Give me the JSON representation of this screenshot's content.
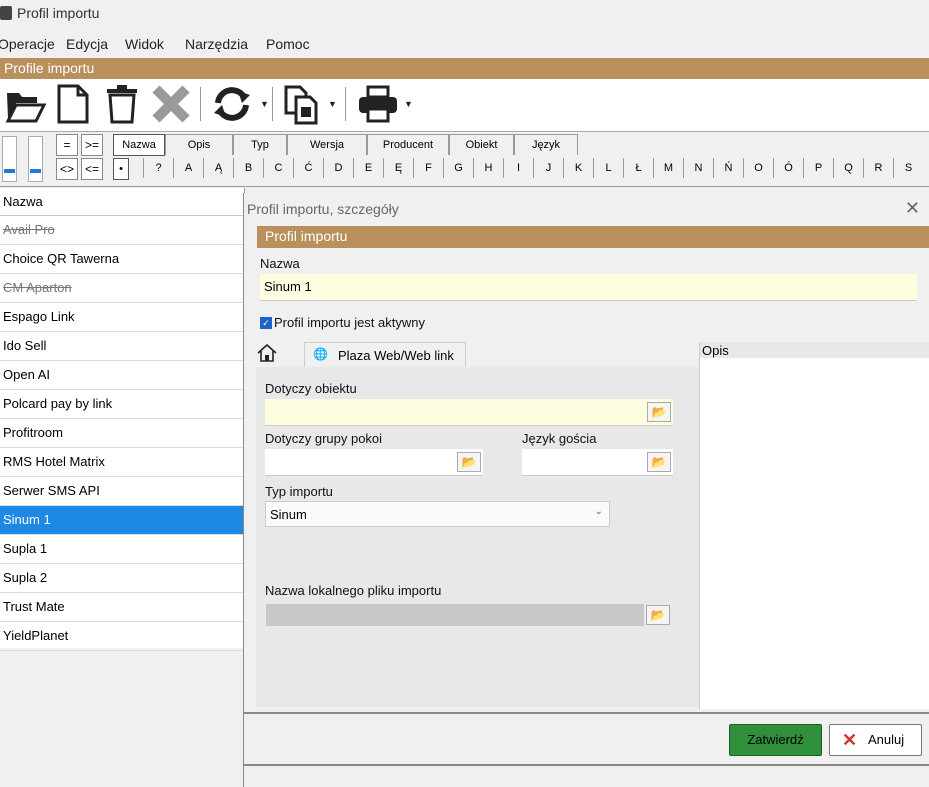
{
  "window": {
    "title": "Profil importu"
  },
  "menu": [
    "Operacje",
    "Edycja",
    "Widok",
    "Narzędzia",
    "Pomoc"
  ],
  "main_header": "Profile importu",
  "toolbar": {
    "icons": [
      "open-folder-icon",
      "new-document-icon",
      "trash-icon",
      "delete-x-icon",
      "refresh-icon",
      "export-icon",
      "print-icon"
    ]
  },
  "filter": {
    "operators": [
      "=",
      ">=",
      "<>",
      "<="
    ],
    "columns": [
      "Nazwa",
      "Opis",
      "Typ",
      "Wersja",
      "Producent",
      "Obiekt",
      "Język"
    ],
    "selected_column": "Nazwa",
    "letters": [
      "•",
      "?",
      "A",
      "Ą",
      "B",
      "C",
      "Ć",
      "D",
      "E",
      "Ę",
      "F",
      "G",
      "H",
      "I",
      "J",
      "K",
      "L",
      "Ł",
      "M",
      "N",
      "Ń",
      "O",
      "Ó",
      "P",
      "Q",
      "R",
      "S"
    ]
  },
  "list": {
    "header": "Nazwa",
    "rows": [
      {
        "name": "Avail Pro",
        "inactive": true
      },
      {
        "name": "Choice QR Tawerna",
        "inactive": false
      },
      {
        "name": "CM Aparton",
        "inactive": true
      },
      {
        "name": "Espago Link",
        "inactive": false
      },
      {
        "name": "Ido Sell",
        "inactive": false
      },
      {
        "name": "Open AI",
        "inactive": false
      },
      {
        "name": "Polcard pay by link",
        "inactive": false
      },
      {
        "name": "Profitroom",
        "inactive": false
      },
      {
        "name": "RMS Hotel Matrix",
        "inactive": false
      },
      {
        "name": "Serwer SMS API",
        "inactive": false
      },
      {
        "name": "Sinum 1",
        "inactive": false,
        "selected": true
      },
      {
        "name": "Supla 1",
        "inactive": false
      },
      {
        "name": "Supla 2",
        "inactive": false
      },
      {
        "name": "Trust Mate",
        "inactive": false
      },
      {
        "name": "YieldPlanet",
        "inactive": false
      }
    ]
  },
  "dialog": {
    "title": "Profil importu, szczegóły",
    "header": "Profil importu",
    "name_label": "Nazwa",
    "name_value": "Sinum 1",
    "active_label": "Profil importu jest aktywny",
    "active_checked": true,
    "tab_home_icon": "home-icon",
    "tab_web_label": "Plaza Web/Web link",
    "object_label": "Dotyczy obiektu",
    "object_value": "",
    "room_group_label": "Dotyczy grupy pokoi",
    "room_group_value": "",
    "guest_lang_label": "Język gościa",
    "guest_lang_value": "",
    "import_type_label": "Typ importu",
    "import_type_value": "Sinum",
    "local_file_label": "Nazwa lokalnego pliku importu",
    "local_file_value": "",
    "opis_label": "Opis",
    "confirm_label": "Zatwierdź",
    "cancel_label": "Anuluj"
  },
  "colors": {
    "brown_header": "#b98f5b",
    "selection": "#1e88e5",
    "confirm_green": "#2f8f3a",
    "field_yellow": "#fffde0"
  }
}
